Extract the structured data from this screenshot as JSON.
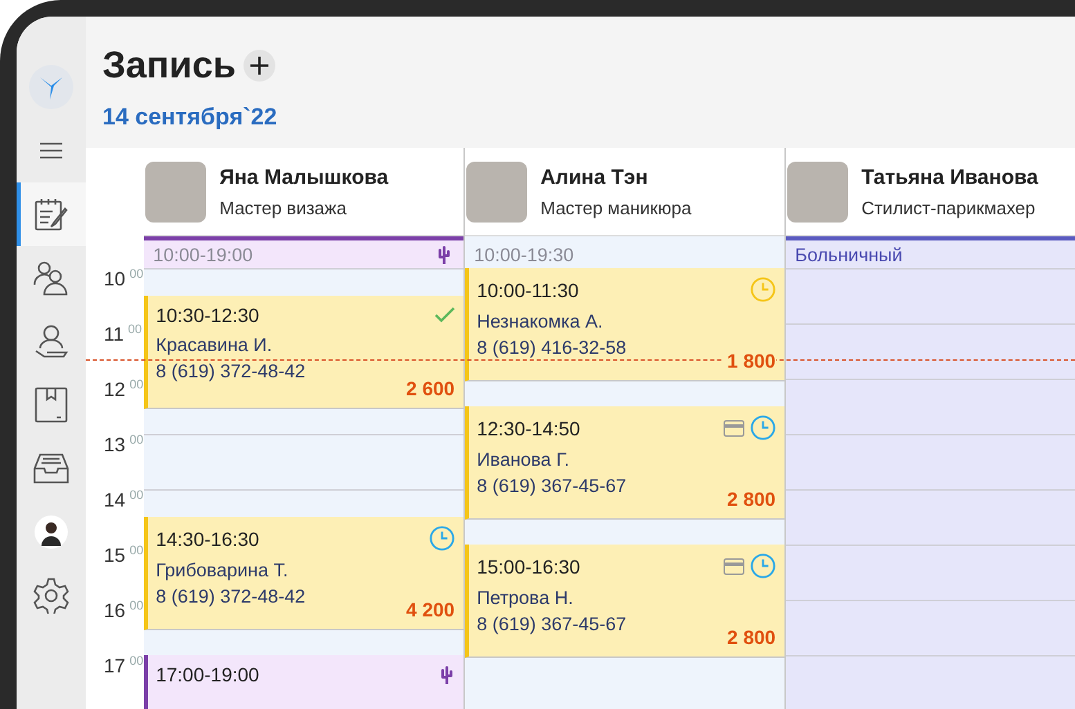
{
  "sidebar": {
    "items": [
      {
        "kind": "logo",
        "selected": false
      },
      {
        "kind": "menu",
        "selected": false
      },
      {
        "kind": "notes",
        "selected": true
      },
      {
        "kind": "users",
        "selected": false
      },
      {
        "kind": "client",
        "selected": false
      },
      {
        "kind": "bookmark",
        "selected": false
      },
      {
        "kind": "inbox",
        "selected": false
      },
      {
        "kind": "avatar",
        "selected": false
      },
      {
        "kind": "settings",
        "selected": false
      }
    ]
  },
  "header": {
    "title": "Запись",
    "date": "14 сентября`22"
  },
  "time_labels": [
    {
      "hour": "10",
      "minutes": "00"
    },
    {
      "hour": "11",
      "minutes": "00"
    },
    {
      "hour": "12",
      "minutes": "00"
    },
    {
      "hour": "13",
      "minutes": "00"
    },
    {
      "hour": "14",
      "minutes": "00"
    },
    {
      "hour": "15",
      "minutes": "00"
    },
    {
      "hour": "16",
      "minutes": "00"
    },
    {
      "hour": "17",
      "minutes": "00"
    }
  ],
  "current_time_line": true,
  "masters": [
    {
      "name": "Яна Малышкова",
      "role": "Мастер визажа",
      "band": {
        "text": "10:00-19:00",
        "kind": "personal"
      },
      "appointments": [
        {
          "kind": "visit",
          "time": "10:30-12:30",
          "client": "Красавина И.",
          "phone": "8 (619) 372-48-42",
          "price": "2 600",
          "confirmed": true,
          "card": false
        },
        {
          "kind": "visit",
          "time": "14:30-16:30",
          "client": "Грибоварина Т.",
          "phone": "8 (619) 372-48-42",
          "price": "4 200",
          "confirmed": false,
          "awaiting": false,
          "card": false
        },
        {
          "kind": "block",
          "time": "17:00-19:00"
        }
      ]
    },
    {
      "name": "Алина Тэн",
      "role": "Мастер маникюра",
      "band": {
        "text": "10:00-19:30",
        "kind": "default"
      },
      "appointments": [
        {
          "kind": "visit",
          "time": "10:00-11:30",
          "client": "Незнакомка А.",
          "phone": "8 (619) 416-32-58",
          "price": "1 800",
          "confirmed": false,
          "awaiting": true,
          "card": false
        },
        {
          "kind": "visit",
          "time": "12:30-14:50",
          "client": "Иванова Г.",
          "phone": "8 (619) 367-45-67",
          "price": "2 800",
          "confirmed": false,
          "awaiting": false,
          "card": true
        },
        {
          "kind": "visit",
          "time": "15:00-16:30",
          "client": "Петрова Н.",
          "phone": "8 (619) 367-45-67",
          "price": "2 800",
          "confirmed": false,
          "awaiting": false,
          "card": true
        }
      ]
    },
    {
      "name": "Татьяна Иванова",
      "role": "Стилист-парикмахер",
      "band": {
        "text": "Больничный",
        "kind": "sick"
      }
    }
  ]
}
